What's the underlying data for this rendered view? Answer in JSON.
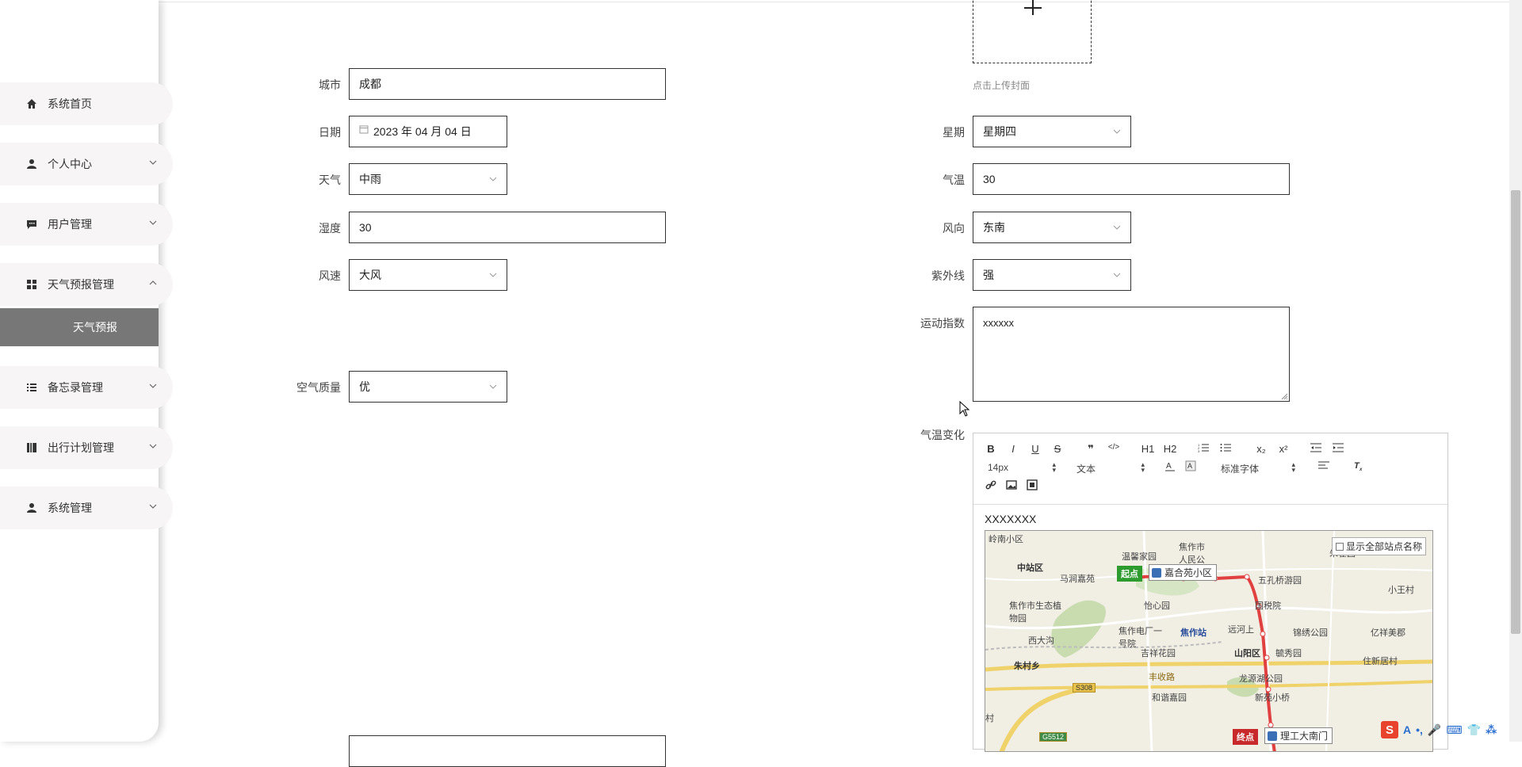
{
  "sidebar": {
    "items": [
      {
        "label": "系统首页",
        "icon": "home-icon",
        "has_arrow": false
      },
      {
        "label": "个人中心",
        "icon": "user-icon",
        "has_arrow": true
      },
      {
        "label": "用户管理",
        "icon": "chat-icon",
        "has_arrow": true
      },
      {
        "label": "天气预报管理",
        "icon": "grid-icon",
        "has_arrow": true,
        "expanded": true
      },
      {
        "label": "备忘录管理",
        "icon": "list-icon",
        "has_arrow": true
      },
      {
        "label": "出行计划管理",
        "icon": "book-icon",
        "has_arrow": true
      },
      {
        "label": "系统管理",
        "icon": "user-icon",
        "has_arrow": true
      }
    ],
    "active_sub": "天气预报"
  },
  "upload": {
    "tip": "点击上传封面"
  },
  "form": {
    "city": {
      "label": "城市",
      "value": "成都"
    },
    "date": {
      "label": "日期",
      "value": "2023 年 04 月 04 日"
    },
    "weekday": {
      "label": "星期",
      "value": "星期四"
    },
    "weather": {
      "label": "天气",
      "value": "中雨"
    },
    "temperature": {
      "label": "气温",
      "value": "30"
    },
    "humidity": {
      "label": "湿度",
      "value": "30"
    },
    "wind_direction": {
      "label": "风向",
      "value": "东南"
    },
    "wind_speed": {
      "label": "风速",
      "value": "大风"
    },
    "uv": {
      "label": "紫外线",
      "value": "强"
    },
    "sport_index": {
      "label": "运动指数",
      "value": "xxxxxx"
    },
    "air_quality": {
      "label": "空气质量",
      "value": "优"
    },
    "temp_change": {
      "label": "气温变化"
    }
  },
  "editor": {
    "toolbar_row1": [
      "B",
      "I",
      "U",
      "S",
      "❞",
      "</>",
      "H1",
      "H2",
      "ol",
      "ul",
      "x₂",
      "x²",
      "outdent",
      "indent"
    ],
    "size_select": "14px",
    "text_select": "文本",
    "font_select": "标准字体",
    "content": "XXXXXXX"
  },
  "map": {
    "checkbox_label": "显示全部站点名称",
    "labels": [
      "岭南小区",
      "中站区",
      "马涧嘉苑",
      "温馨家园",
      "焦作市人民公园",
      "朱雀园",
      "五孔桥游园",
      "小王村",
      "焦作市生态植物园",
      "怡心园",
      "国税院",
      "焦作电厂一号院",
      "焦作站",
      "远河上",
      "锦绣公园",
      "亿祥美郡",
      "西大沟",
      "吉祥花园",
      "山阳区",
      "毓秀园",
      "住新居村",
      "朱村乡",
      "丰收路",
      "龙源湖公园",
      "和谐嘉园",
      "新苑小桥",
      "村"
    ],
    "start_tag": "起点",
    "start_stop": "嘉合苑小区",
    "end_tag": "终点",
    "end_stop": "理工大南门",
    "road_s308": "S308",
    "road_g5512": "G5512"
  },
  "ime": {
    "logo": "S",
    "items": [
      "A",
      "•,",
      "🎤",
      "⌨",
      "👕",
      "⁂"
    ]
  }
}
